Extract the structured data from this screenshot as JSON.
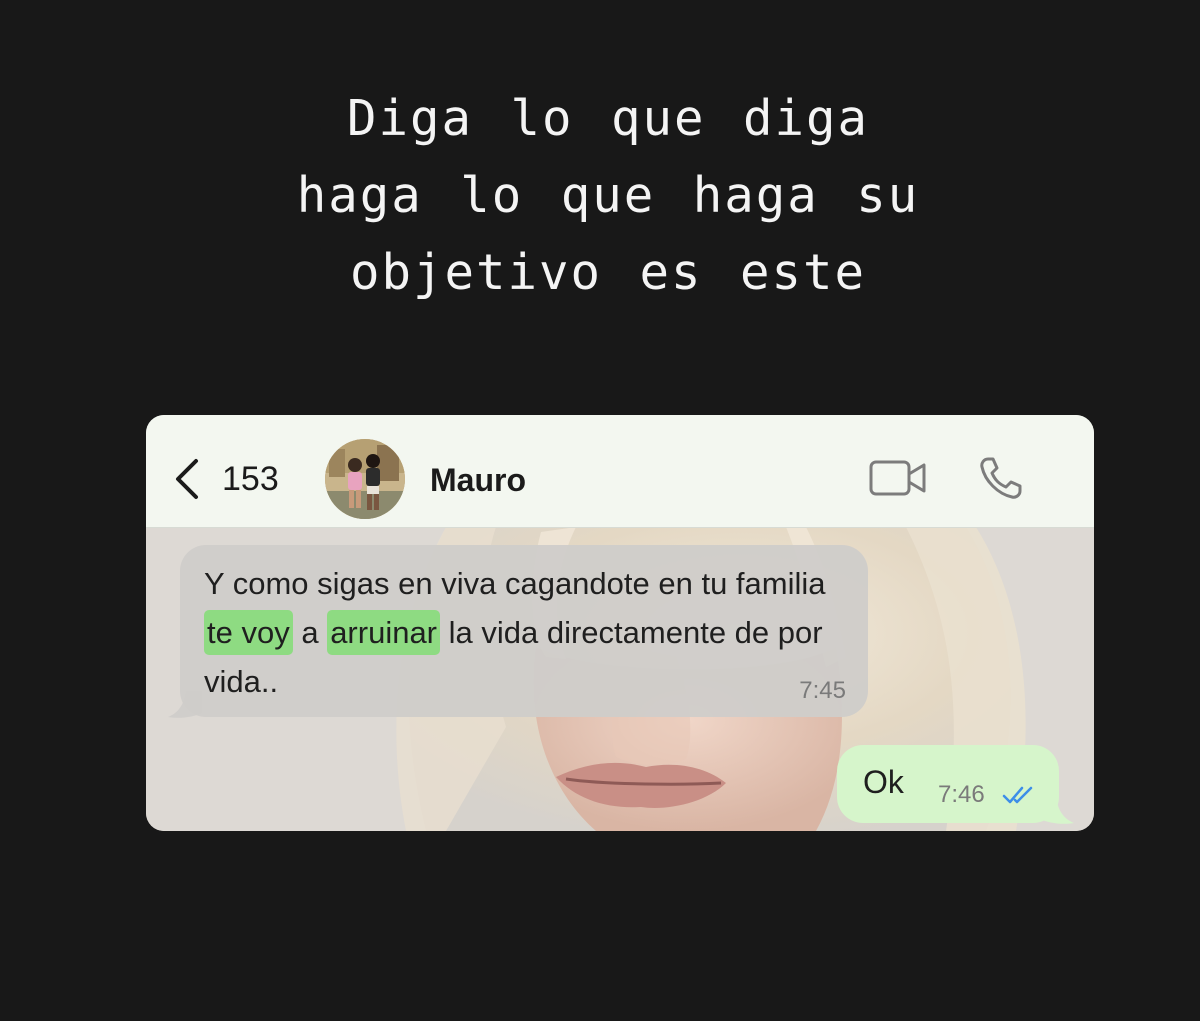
{
  "headline": {
    "line1": "Diga lo que diga",
    "line2": "haga lo que haga su",
    "line3": "objetivo es este"
  },
  "chat": {
    "back_count": "153",
    "contact_name": "Mauro",
    "icons": {
      "back": "chevron-left-icon",
      "video": "video-camera-icon",
      "call": "phone-icon",
      "read_receipt": "double-check-icon"
    },
    "colors": {
      "header_bg": "#f3f7f0",
      "incoming_bubble": "#cfcdca",
      "outgoing_bubble": "#d6f5cb",
      "highlight": "#8edb82",
      "read_receipt": "#3d8ee8"
    },
    "messages": [
      {
        "direction": "incoming",
        "segments": [
          {
            "text": "Y como sigas en viva cagandote en tu familia ",
            "highlighted": false
          },
          {
            "text": "te voy",
            "highlighted": true
          },
          {
            "text": " a ",
            "highlighted": false
          },
          {
            "text": "arruinar",
            "highlighted": true
          },
          {
            "text": " la vida directamente de por vida..",
            "highlighted": false
          }
        ],
        "time": "7:45"
      },
      {
        "direction": "outgoing",
        "text": "Ok",
        "time": "7:46",
        "status": "read"
      }
    ]
  }
}
